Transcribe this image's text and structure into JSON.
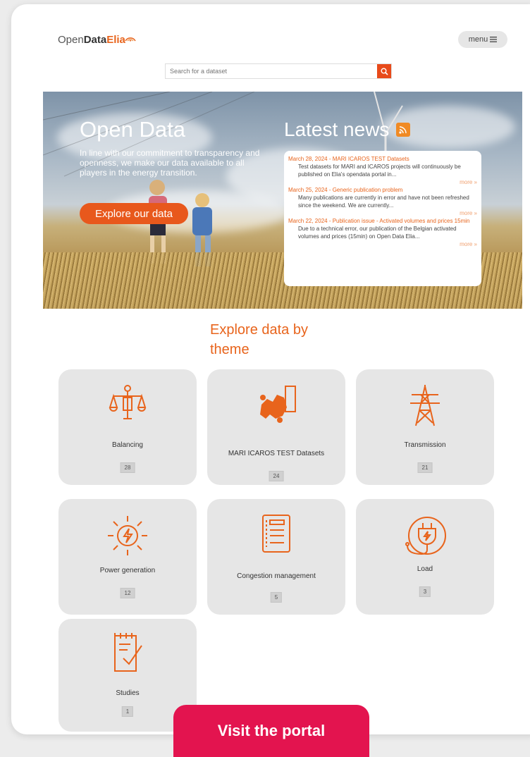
{
  "header": {
    "logo_open": "Open",
    "logo_data": "Data",
    "logo_elia": "Elia",
    "menu_label": "menu"
  },
  "search": {
    "placeholder": "Search for a dataset"
  },
  "hero": {
    "title": "Open Data",
    "text": "In line with our commitment to transparency and openness, we make our data available to all players in the energy transition.",
    "button": "Explore our data"
  },
  "news": {
    "title": "Latest news",
    "items": [
      {
        "title": "March 28, 2024 - MARI ICAROS TEST Datasets",
        "desc": "Test datasets for MARI and ICAROS projects will continuously be published on Elia's opendata portal in...",
        "more": "more »"
      },
      {
        "title": "March 25, 2024 - Generic publication problem",
        "desc": "Many publications are currently in error and have not been refreshed since the weekend. We are currently...",
        "more": "more »"
      },
      {
        "title": "March 22, 2024 - Publication issue - Activated volumes and prices 15min",
        "desc": "Due to a technical error, our publication of the Belgian activated volumes and prices (15min) on Open Data Elia...",
        "more": "more »"
      }
    ]
  },
  "themes": {
    "title": "Explore data by theme",
    "items": [
      {
        "label": "Balancing",
        "count": "28",
        "icon": "scales-icon"
      },
      {
        "label": "MARI ICAROS TEST Datasets",
        "count": "24",
        "icon": "europe-map-icon"
      },
      {
        "label": "Transmission",
        "count": "21",
        "icon": "pylon-icon"
      },
      {
        "label": "Power generation",
        "count": "12",
        "icon": "power-sun-icon"
      },
      {
        "label": "Congestion management",
        "count": "5",
        "icon": "document-icon"
      },
      {
        "label": "Load",
        "count": "3",
        "icon": "plug-icon"
      },
      {
        "label": "Studies",
        "count": "1",
        "icon": "checklist-icon"
      }
    ]
  },
  "cta": {
    "label": "Visit the portal"
  },
  "colors": {
    "accent": "#e8641c",
    "cta": "#e3144f",
    "tile": "#e6e6e6"
  }
}
